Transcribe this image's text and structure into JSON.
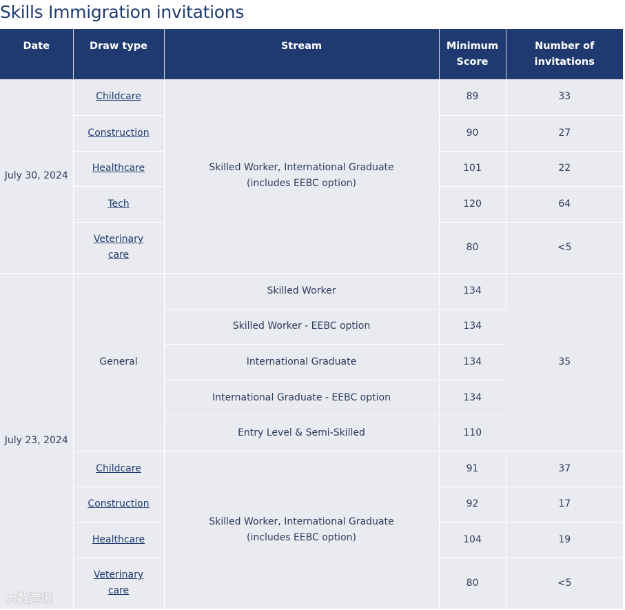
{
  "page": {
    "title": "Skills Immigration invitations"
  },
  "table": {
    "headers": [
      "Date",
      "Draw type",
      "Stream",
      "Minimum Score",
      "Number of invitations"
    ],
    "block1": {
      "date": "July 30, 2024",
      "stream": "Skilled Worker, International Graduate (includes EEBC option)",
      "rows": [
        {
          "type": "Childcare",
          "score": "89",
          "invites": "33"
        },
        {
          "type": "Construction",
          "score": "90",
          "invites": "27"
        },
        {
          "type": "Healthcare",
          "score": "101",
          "invites": "22"
        },
        {
          "type": "Tech",
          "score": "120",
          "invites": "64"
        },
        {
          "type": "Veterinary care",
          "score": "80",
          "invites": "<5"
        }
      ]
    },
    "block2": {
      "date": "July 23, 2024",
      "general": {
        "type": "General",
        "invites": "35",
        "rows": [
          {
            "stream": "Skilled Worker",
            "score": "134"
          },
          {
            "stream": "Skilled Worker - EEBC option",
            "score": "134"
          },
          {
            "stream": "International Graduate",
            "score": "134"
          },
          {
            "stream": "International Graduate - EEBC option",
            "score": "134"
          },
          {
            "stream": "Entry Level & Semi-Skilled",
            "score": "110"
          }
        ]
      },
      "stream": "Skilled Worker, International Graduate (includes EEBC option)",
      "rows": [
        {
          "type": "Childcare",
          "score": "91",
          "invites": "37"
        },
        {
          "type": "Construction",
          "score": "92",
          "invites": "17"
        },
        {
          "type": "Healthcare",
          "score": "104",
          "invites": "19"
        },
        {
          "type": "Veterinary care",
          "score": "80",
          "invites": "<5"
        }
      ]
    }
  },
  "watermark": "大数跨境"
}
